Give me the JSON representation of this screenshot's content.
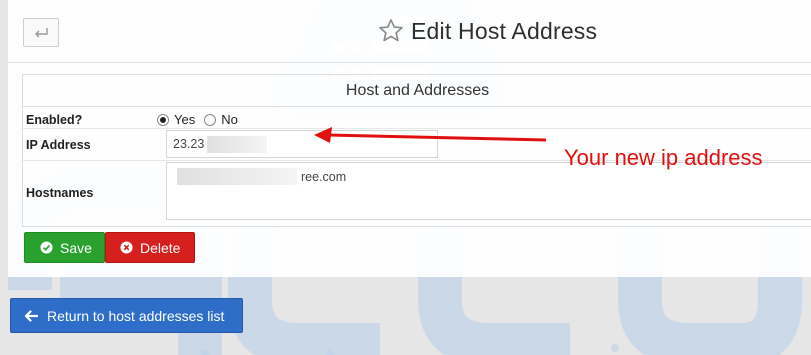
{
  "header": {
    "back_icon": "return-arrow-icon",
    "title": "Edit Host Address",
    "title_icon": "star-outline-icon"
  },
  "form": {
    "section_title": "Host and Addresses",
    "enabled_label": "Enabled?",
    "enabled_options": [
      {
        "label": "Yes",
        "checked": true
      },
      {
        "label": "No",
        "checked": false
      }
    ],
    "ip_label": "IP Address",
    "ip_value_visible": "23.23",
    "hostnames_label": "Hostnames",
    "hostnames_value_visible": "ree.com"
  },
  "actions": {
    "save_label": "Save",
    "delete_label": "Delete",
    "return_label": "Return to host addresses list"
  },
  "annotation": {
    "text": "Your new ip address",
    "color": "#e0100e"
  },
  "colors": {
    "save": "#2aa12e",
    "delete": "#d6201d",
    "return": "#2e6ec9",
    "watermark": "#b9cfe8"
  }
}
